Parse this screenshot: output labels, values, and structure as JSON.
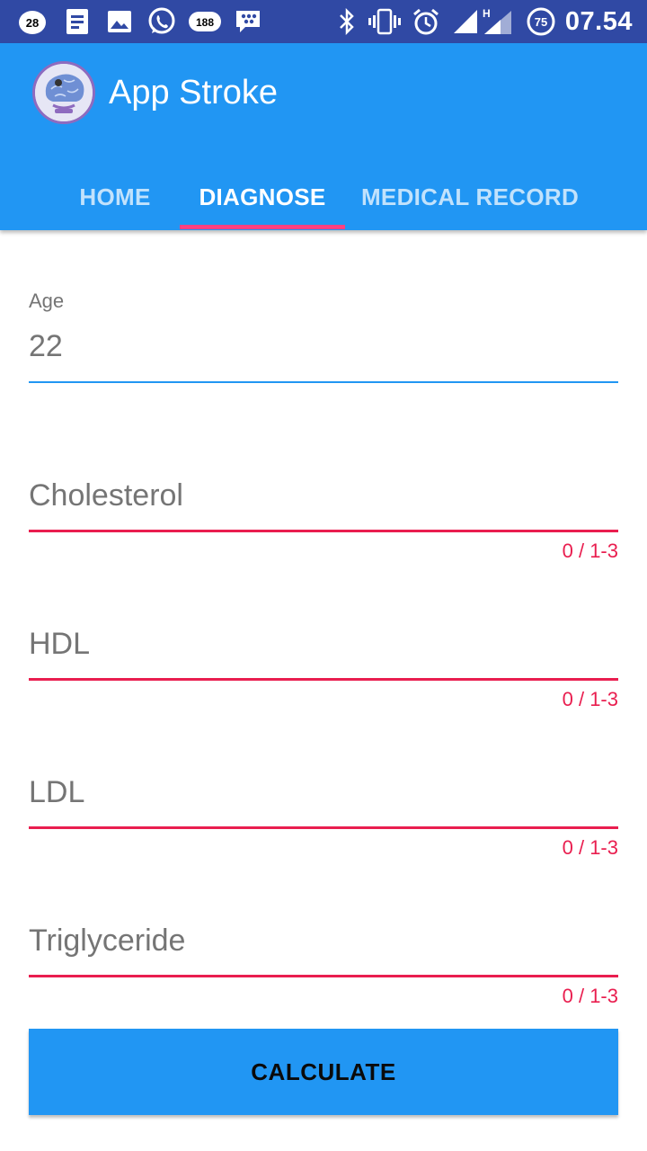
{
  "status_bar": {
    "notifications": [
      {
        "icon": "badge-28-icon",
        "text": "28"
      },
      {
        "icon": "document-icon"
      },
      {
        "icon": "image-icon"
      },
      {
        "icon": "whatsapp-icon"
      },
      {
        "icon": "badge-188-icon",
        "text": "188"
      },
      {
        "icon": "bbm-icon"
      }
    ],
    "system": [
      {
        "icon": "bluetooth-icon"
      },
      {
        "icon": "vibrate-icon"
      },
      {
        "icon": "alarm-icon"
      },
      {
        "icon": "signal-icon"
      },
      {
        "icon": "signal-h-icon",
        "text": "H"
      },
      {
        "icon": "battery-icon",
        "text": "75"
      }
    ],
    "time": "07.54"
  },
  "app_bar": {
    "title": "App Stroke",
    "logo_icon": "brain-logo-icon",
    "tabs": [
      {
        "label": "HOME",
        "active": false
      },
      {
        "label": "DIAGNOSE",
        "active": true
      },
      {
        "label": "MEDICAL RECORD",
        "active": false
      }
    ]
  },
  "form": {
    "age": {
      "label": "Age",
      "value": "22"
    },
    "cholesterol": {
      "placeholder": "Cholesterol",
      "value": "",
      "counter": "0 / 1-3"
    },
    "hdl": {
      "placeholder": "HDL",
      "value": "",
      "counter": "0 / 1-3"
    },
    "ldl": {
      "placeholder": "LDL",
      "value": "",
      "counter": "0 / 1-3"
    },
    "triglyceride": {
      "placeholder": "Triglyceride",
      "value": "",
      "counter": "0 / 1-3"
    }
  },
  "calculate_button": {
    "label": "CALCULATE"
  },
  "colors": {
    "status_bar": "#3049a4",
    "primary": "#2196f3",
    "tab_indicator": "#ff4081",
    "error": "#e91e4f",
    "hint_text": "#757575"
  }
}
